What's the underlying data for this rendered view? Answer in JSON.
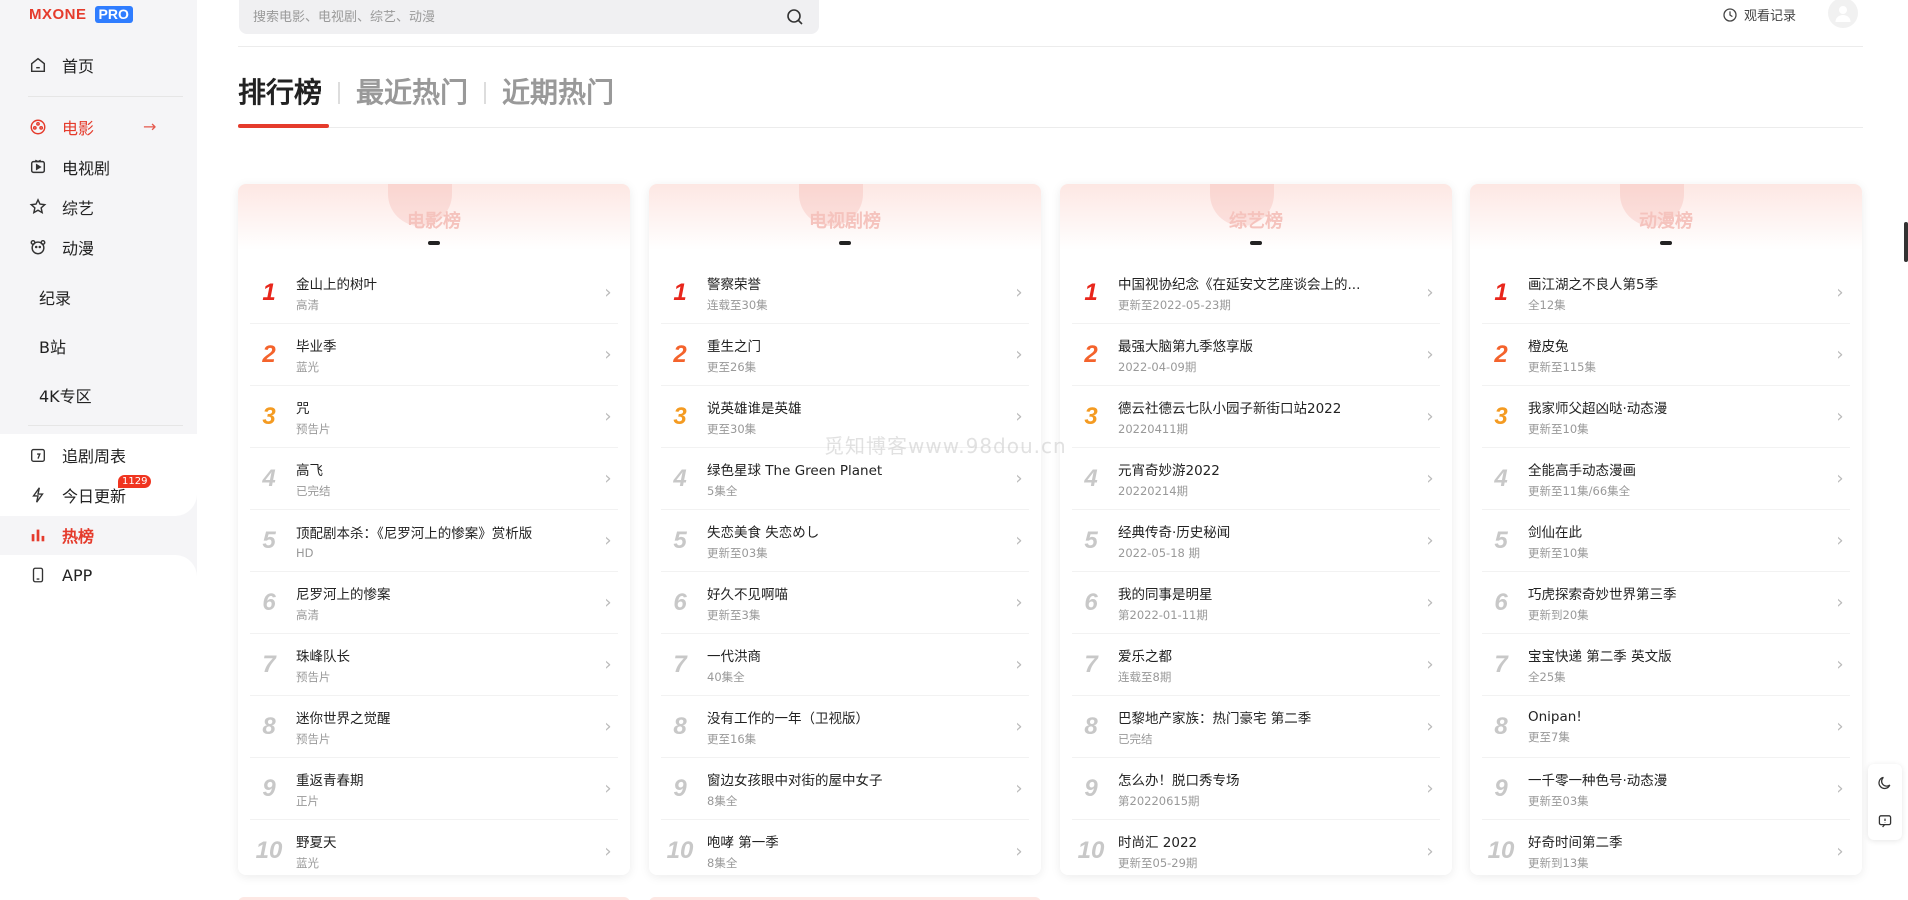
{
  "logo": {
    "brand": "MXONE",
    "badge": "PRO"
  },
  "sidebar": {
    "items": [
      {
        "label": "首页",
        "icon": "home-icon"
      },
      {
        "label": "电影",
        "icon": "film-icon",
        "active": true
      },
      {
        "label": "电视剧",
        "icon": "tv-icon"
      },
      {
        "label": "综艺",
        "icon": "variety-icon"
      },
      {
        "label": "动漫",
        "icon": "anime-icon"
      }
    ],
    "sub_items": [
      "纪录",
      "B站",
      "4K专区"
    ],
    "bottom_items": [
      {
        "label": "追剧周表",
        "icon": "calendar-icon"
      },
      {
        "label": "今日更新",
        "icon": "bolt-icon",
        "badge": "1129"
      },
      {
        "label": "热榜",
        "icon": "chart-icon",
        "active": true
      },
      {
        "label": "APP",
        "icon": "phone-icon"
      }
    ]
  },
  "header": {
    "search_placeholder": "搜索电影、电视剧、综艺、动漫",
    "history_label": "观看记录"
  },
  "tabs": [
    "排行榜",
    "最近热门",
    "近期热门"
  ],
  "watermark": "觅知博客www.98dou.cn",
  "colors": {
    "accent": "#e53b2c",
    "rank1": "#e8261b",
    "rank2": "#f4632c",
    "rank3": "#f49b22"
  },
  "cards": [
    {
      "title": "电影榜",
      "items": [
        {
          "rank": "1",
          "name": "金山上的树叶",
          "sub": "高清"
        },
        {
          "rank": "2",
          "name": "毕业季",
          "sub": "蓝光"
        },
        {
          "rank": "3",
          "name": "咒",
          "sub": "预告片"
        },
        {
          "rank": "4",
          "name": "高飞",
          "sub": "已完结"
        },
        {
          "rank": "5",
          "name": "顶配剧本杀：《尼罗河上的惨案》赏析版",
          "sub": "HD"
        },
        {
          "rank": "6",
          "name": "尼罗河上的惨案",
          "sub": "高清"
        },
        {
          "rank": "7",
          "name": "珠峰队长",
          "sub": "预告片"
        },
        {
          "rank": "8",
          "name": "迷你世界之觉醒",
          "sub": "预告片"
        },
        {
          "rank": "9",
          "name": "重返青春期",
          "sub": "正片"
        },
        {
          "rank": "10",
          "name": "野夏天",
          "sub": "蓝光"
        }
      ]
    },
    {
      "title": "电视剧榜",
      "items": [
        {
          "rank": "1",
          "name": "警察荣誉",
          "sub": "连载至30集"
        },
        {
          "rank": "2",
          "name": "重生之门",
          "sub": "更至26集"
        },
        {
          "rank": "3",
          "name": "说英雄谁是英雄",
          "sub": "更至30集"
        },
        {
          "rank": "4",
          "name": "绿色星球 The Green Planet",
          "sub": "5集全"
        },
        {
          "rank": "5",
          "name": "失恋美食 失恋めし",
          "sub": "更新至03集"
        },
        {
          "rank": "6",
          "name": "好久不见啊喵",
          "sub": "更新至3集"
        },
        {
          "rank": "7",
          "name": "一代洪商",
          "sub": "40集全"
        },
        {
          "rank": "8",
          "name": "没有工作的一年（卫视版）",
          "sub": "更至16集"
        },
        {
          "rank": "9",
          "name": "窗边女孩眼中对街的屋中女子",
          "sub": "8集全"
        },
        {
          "rank": "10",
          "name": "咆哮 第一季",
          "sub": "8集全"
        }
      ]
    },
    {
      "title": "综艺榜",
      "items": [
        {
          "rank": "1",
          "name": "中国视协纪念《在延安文艺座谈会上的...",
          "sub": "更新至2022-05-23期"
        },
        {
          "rank": "2",
          "name": "最强大脑第九季悠享版",
          "sub": "2022-04-09期"
        },
        {
          "rank": "3",
          "name": "德云社德云七队小园子新街口站2022",
          "sub": "20220411期"
        },
        {
          "rank": "4",
          "name": "元宵奇妙游2022",
          "sub": "20220214期"
        },
        {
          "rank": "5",
          "name": "经典传奇·历史秘闻",
          "sub": "2022-05-18 期"
        },
        {
          "rank": "6",
          "name": "我的同事是明星",
          "sub": "第2022-01-11期"
        },
        {
          "rank": "7",
          "name": "爱乐之都",
          "sub": "连载至8期"
        },
        {
          "rank": "8",
          "name": "巴黎地产家族：热门豪宅 第二季",
          "sub": "已完结"
        },
        {
          "rank": "9",
          "name": "怎么办！脱口秀专场",
          "sub": "第20220615期"
        },
        {
          "rank": "10",
          "name": "时尚汇 2022",
          "sub": "更新至05-29期"
        }
      ]
    },
    {
      "title": "动漫榜",
      "items": [
        {
          "rank": "1",
          "name": "画江湖之不良人第5季",
          "sub": "全12集"
        },
        {
          "rank": "2",
          "name": "橙皮兔",
          "sub": "更新至115集"
        },
        {
          "rank": "3",
          "name": "我家师父超凶哒·动态漫",
          "sub": "更新至10集"
        },
        {
          "rank": "4",
          "name": "全能高手动态漫画",
          "sub": "更新至11集/66集全"
        },
        {
          "rank": "5",
          "name": "剑仙在此",
          "sub": "更新至10集"
        },
        {
          "rank": "6",
          "name": "巧虎探索奇妙世界第三季",
          "sub": "更新到20集"
        },
        {
          "rank": "7",
          "name": "宝宝快递 第二季 英文版",
          "sub": "全25集"
        },
        {
          "rank": "8",
          "name": "Onipan!",
          "sub": "更至7集"
        },
        {
          "rank": "9",
          "name": "一千零一种色号·动态漫",
          "sub": "更新至03集"
        },
        {
          "rank": "10",
          "name": "好奇时间第二季",
          "sub": "更新到13集"
        }
      ]
    }
  ]
}
